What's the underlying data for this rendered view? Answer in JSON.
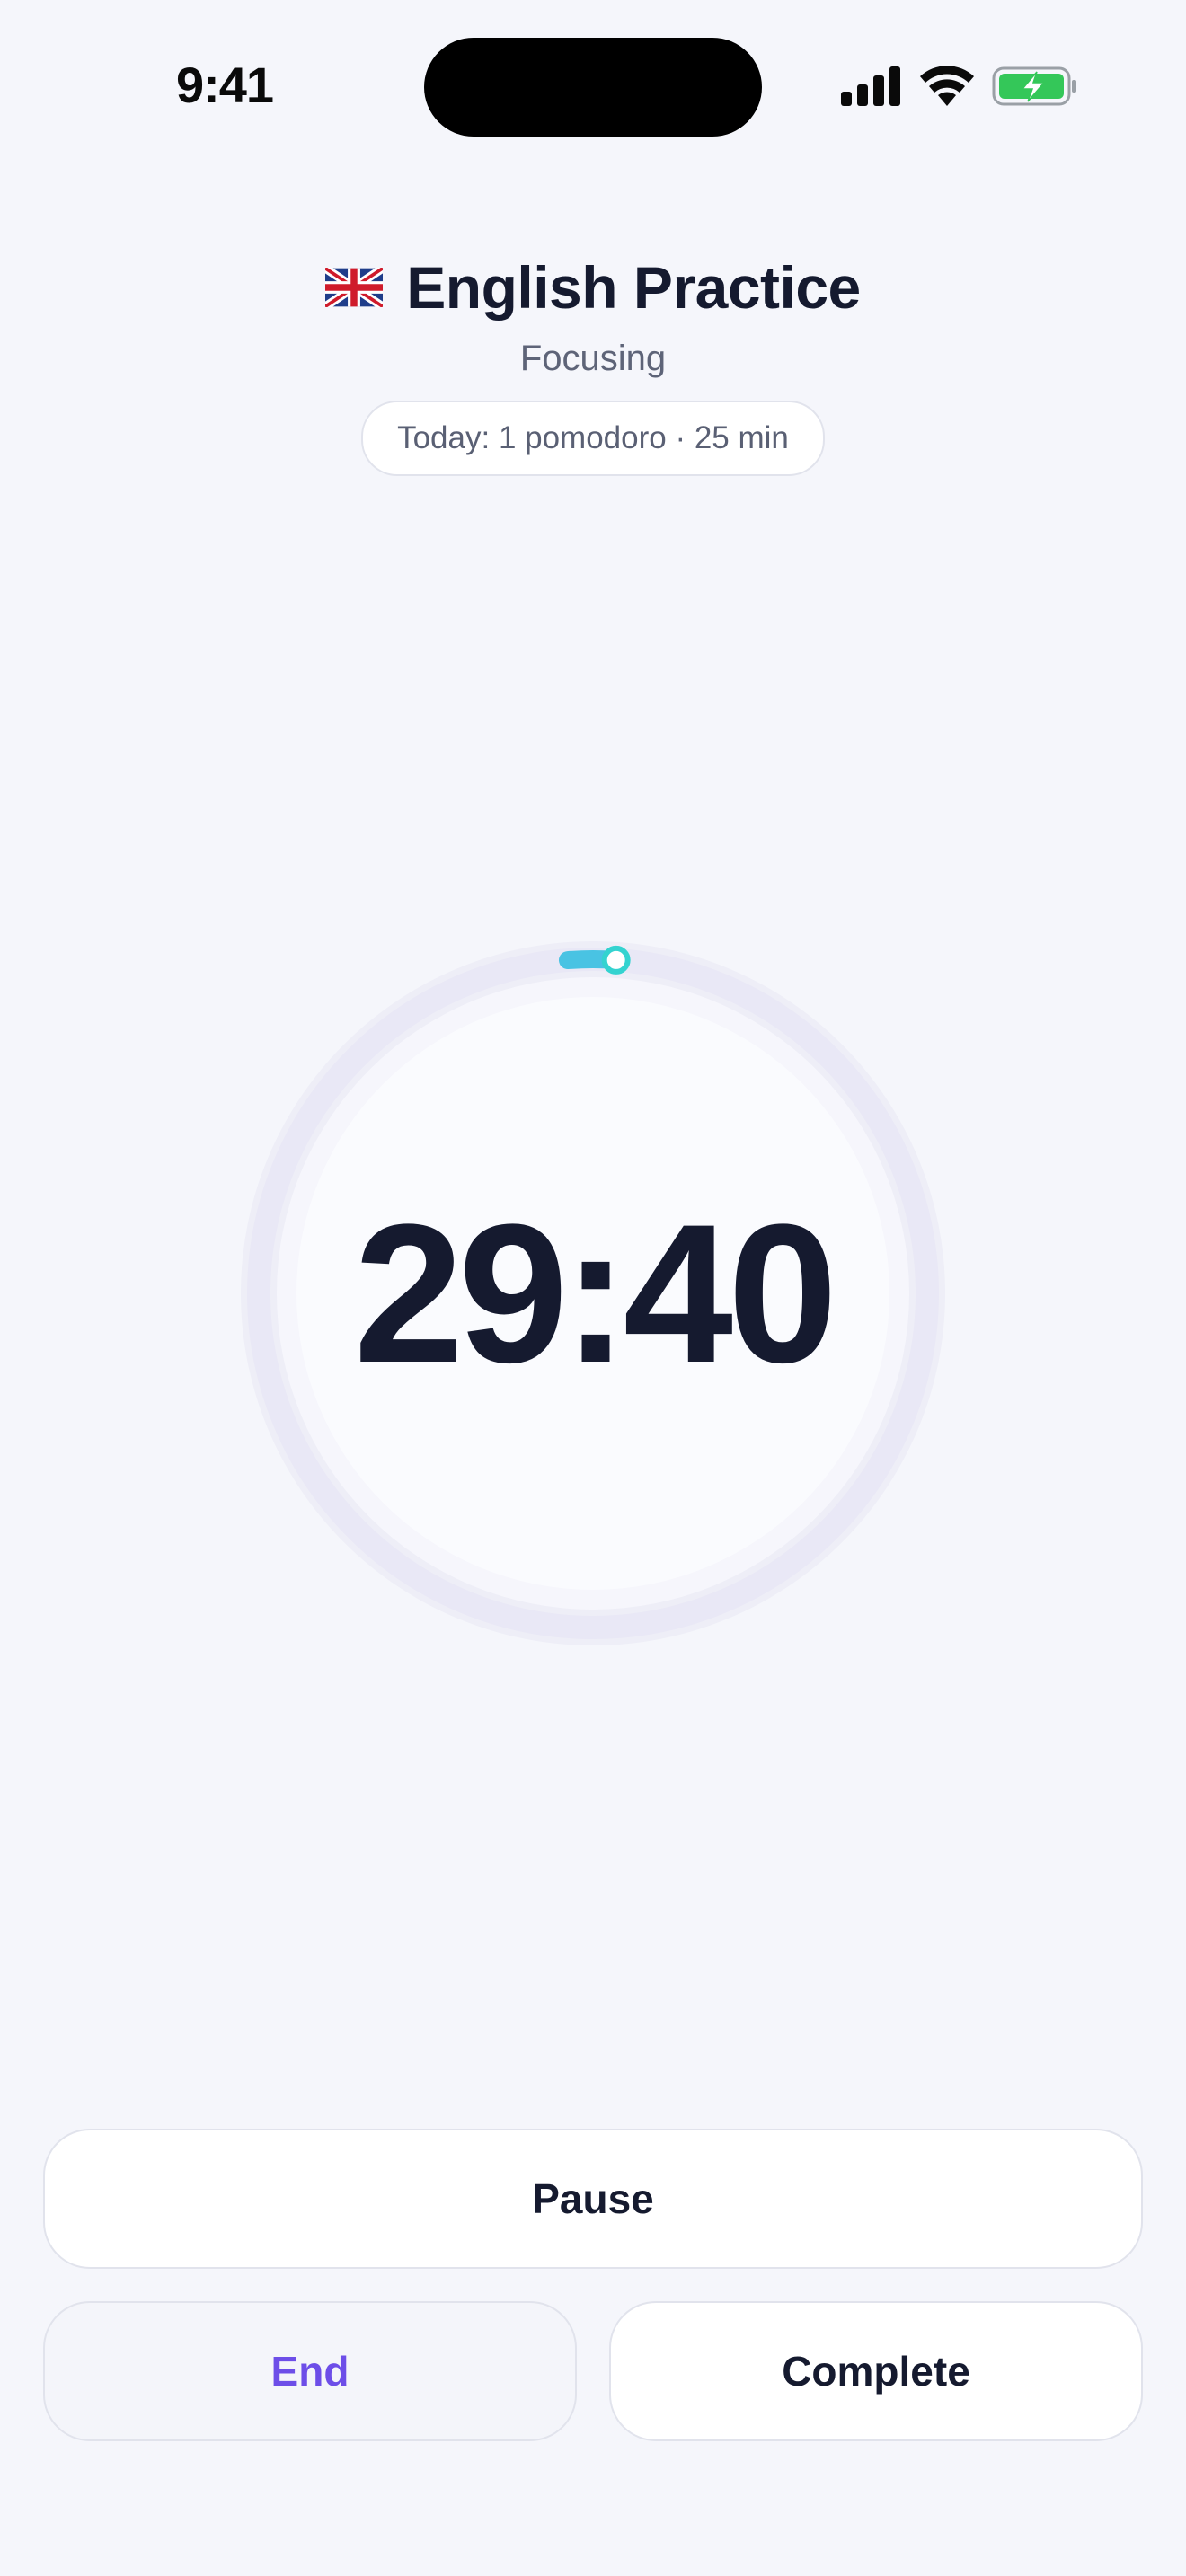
{
  "status_bar": {
    "time": "9:41",
    "signal_icon": "cellular-signal-icon",
    "wifi_icon": "wifi-icon",
    "battery_icon": "battery-charging-icon",
    "battery_color": "#34c759"
  },
  "header": {
    "flag_icon": "uk-flag-icon",
    "title": "English Practice",
    "status": "Focusing",
    "today_summary": "Today: 1 pomodoro · 25 min"
  },
  "timer": {
    "display": "29:40",
    "progress_fraction": 0.011,
    "ring_color": "#e9e8f6",
    "progress_color": "#49c3e3",
    "knob_color": "#34d3d0"
  },
  "actions": {
    "pause_label": "Pause",
    "end_label": "End",
    "complete_label": "Complete",
    "accent_color": "#6d4ee8"
  }
}
